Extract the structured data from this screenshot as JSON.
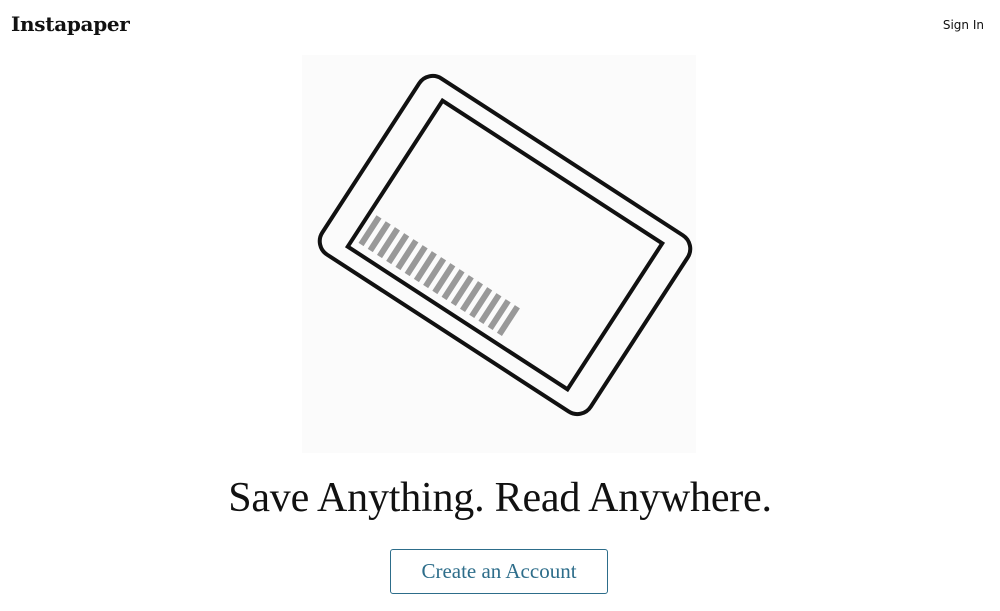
{
  "header": {
    "logo_text": "Instapaper",
    "signin_label": "Sign In"
  },
  "hero": {
    "illustration_icon": "tablet-reading-icon",
    "tagline": "Save Anything. Read Anywhere.",
    "cta_label": "Create an Account"
  },
  "colors": {
    "text": "#111111",
    "accent": "#2d6d8a",
    "text_bars": "#999999"
  }
}
